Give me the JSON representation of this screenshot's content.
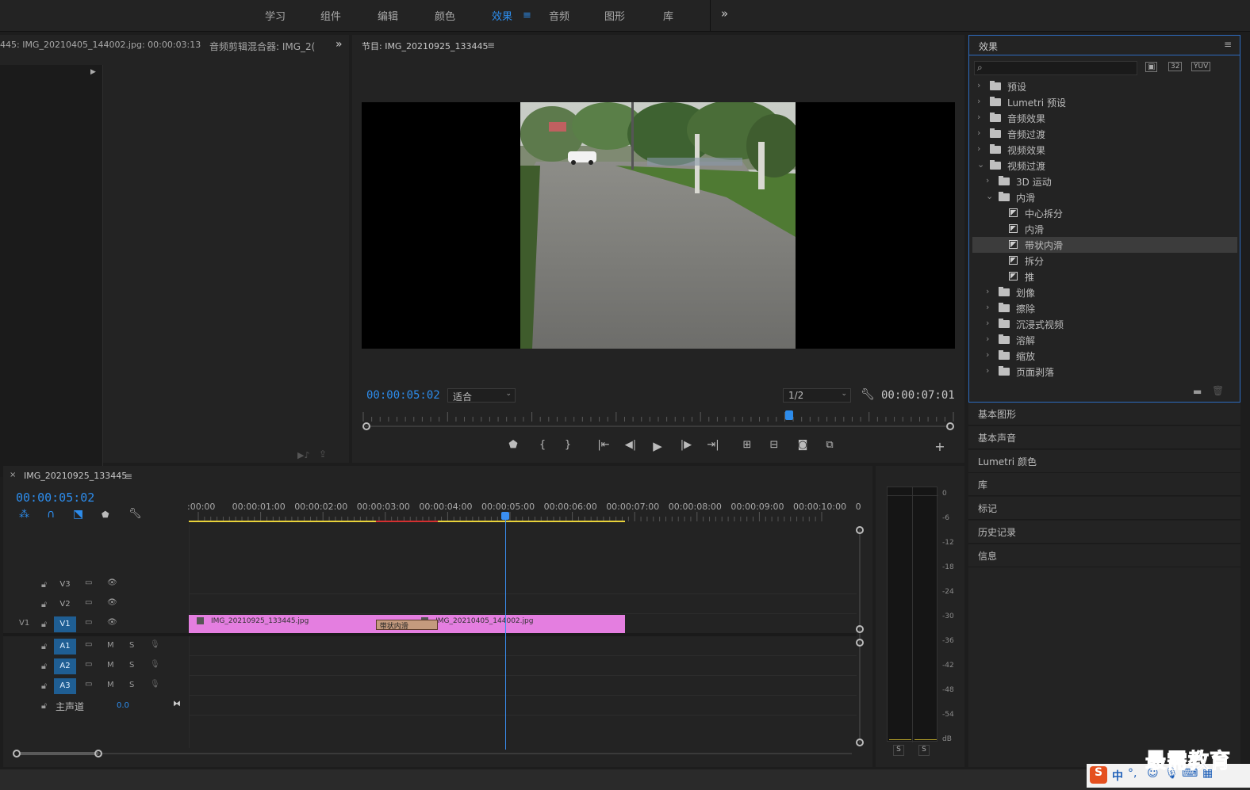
{
  "workspaces": [
    "学习",
    "组件",
    "编辑",
    "颜色",
    "效果",
    "音频",
    "图形",
    "库"
  ],
  "active_workspace": "效果",
  "more_label": "»",
  "source": {
    "tab1": "445: IMG_20210405_144002.jpg: 00:00:03:13",
    "tab2": "音频剪辑混合器: IMG_2("
  },
  "program": {
    "title": "节目: IMG_20210925_133445",
    "timecode": "00:00:05:02",
    "fit": "适合",
    "resolution": "1/2",
    "duration": "00:00:07:01",
    "playhead_fraction": 0.72
  },
  "effects": {
    "title": "效果",
    "search_placeholder": "",
    "tree": [
      {
        "label": "预设",
        "depth": 0,
        "kind": "special-folder",
        "open": false
      },
      {
        "label": "Lumetri 预设",
        "depth": 0,
        "kind": "special-folder",
        "open": false
      },
      {
        "label": "音频效果",
        "depth": 0,
        "kind": "folder",
        "open": false
      },
      {
        "label": "音频过渡",
        "depth": 0,
        "kind": "folder",
        "open": false
      },
      {
        "label": "视频效果",
        "depth": 0,
        "kind": "folder",
        "open": false
      },
      {
        "label": "视频过渡",
        "depth": 0,
        "kind": "folder",
        "open": true
      },
      {
        "label": "3D 运动",
        "depth": 1,
        "kind": "folder",
        "open": false
      },
      {
        "label": "内滑",
        "depth": 1,
        "kind": "folder",
        "open": true
      },
      {
        "label": "中心拆分",
        "depth": 2,
        "kind": "effect"
      },
      {
        "label": "内滑",
        "depth": 2,
        "kind": "effect"
      },
      {
        "label": "带状内滑",
        "depth": 2,
        "kind": "effect",
        "selected": true
      },
      {
        "label": "拆分",
        "depth": 2,
        "kind": "effect"
      },
      {
        "label": "推",
        "depth": 2,
        "kind": "effect"
      },
      {
        "label": "划像",
        "depth": 1,
        "kind": "folder",
        "open": false
      },
      {
        "label": "擦除",
        "depth": 1,
        "kind": "folder",
        "open": false
      },
      {
        "label": "沉浸式视频",
        "depth": 1,
        "kind": "folder",
        "open": false
      },
      {
        "label": "溶解",
        "depth": 1,
        "kind": "folder",
        "open": false
      },
      {
        "label": "缩放",
        "depth": 1,
        "kind": "folder",
        "open": false
      },
      {
        "label": "页面剥落",
        "depth": 1,
        "kind": "folder",
        "open": false
      }
    ]
  },
  "side_panels": [
    "基本图形",
    "基本声音",
    "Lumetri 颜色",
    "库",
    "标记",
    "历史记录",
    "信息"
  ],
  "timeline": {
    "tab_name": "IMG_20210925_133445",
    "timecode": "00:00:05:02",
    "ruler": [
      ":00:00",
      "00:00:01:00",
      "00:00:02:00",
      "00:00:03:00",
      "00:00:04:00",
      "00:00:05:00",
      "00:00:06:00",
      "00:00:07:00",
      "00:00:08:00",
      "00:00:09:00",
      "00:00:10:00",
      "0"
    ],
    "playhead_seconds": 5.07,
    "tracks": {
      "video": [
        {
          "id": "V3",
          "source": ""
        },
        {
          "id": "V2",
          "source": ""
        },
        {
          "id": "V1",
          "source": "V1"
        }
      ],
      "audio": [
        {
          "id": "A1",
          "m": "M",
          "s": "S"
        },
        {
          "id": "A2",
          "m": "M",
          "s": "S"
        },
        {
          "id": "A3",
          "m": "M",
          "s": "S"
        }
      ],
      "master": {
        "label": "主声道",
        "value": "0.0"
      }
    },
    "clips": [
      {
        "name": "IMG_20210925_133445.jpg",
        "start": 0,
        "end": 3.5
      },
      {
        "name": "IMG_20210405_144002.jpg",
        "start": 3.5,
        "end": 7.0
      }
    ],
    "transition": {
      "name": "带状内滑",
      "start": 3.0,
      "end": 4.0
    }
  },
  "meter": {
    "scale": [
      "0",
      "-6",
      "-12",
      "-18",
      "-24",
      "-30",
      "-36",
      "-42",
      "-48",
      "-54",
      "dB"
    ],
    "solo": [
      "S",
      "S"
    ]
  },
  "colors": {
    "accent": "#2d8ceb",
    "clip": "#e47ee0",
    "transition": "#c49a7e",
    "panel": "#232323"
  },
  "watermark": "最需教育",
  "ime": {
    "label": "中"
  }
}
